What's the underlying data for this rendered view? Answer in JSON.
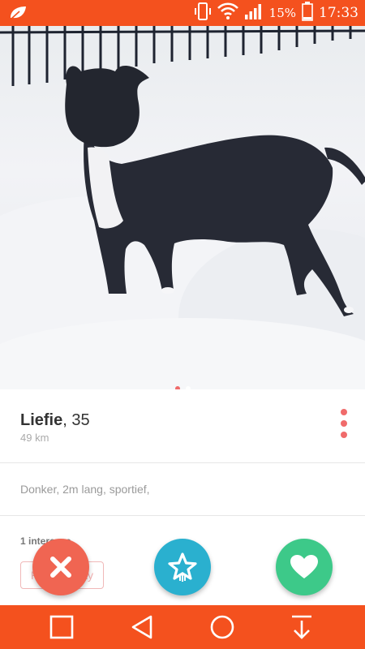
{
  "status_bar": {
    "battery": "15%",
    "time": "17:33",
    "icons": [
      "leaf-icon",
      "phone-vibrate-icon",
      "wifi-icon",
      "signal-icon",
      "battery-icon"
    ]
  },
  "photo": {
    "description_icon": "dog-in-snow-photo",
    "page_count": 2,
    "active_page": 1
  },
  "profile": {
    "name": "Liefie",
    "age_text": ", 35",
    "distance": "49 km"
  },
  "bio": {
    "text": "Donker, 2m lang, sportief,"
  },
  "interests": {
    "count_label": "1 interesse",
    "chip": "Pizza Friday"
  },
  "actions": {
    "nope_icon": "close-icon",
    "super_like_icon": "star-icon",
    "like_icon": "heart-icon"
  },
  "colors": {
    "brand": "#f4511e",
    "nope": "#f06552",
    "super_like": "#2ab0cf",
    "like": "#3dc989"
  },
  "nav": {
    "icons": [
      "recent-apps-icon",
      "back-icon",
      "home-icon",
      "notifications-down-icon"
    ]
  }
}
